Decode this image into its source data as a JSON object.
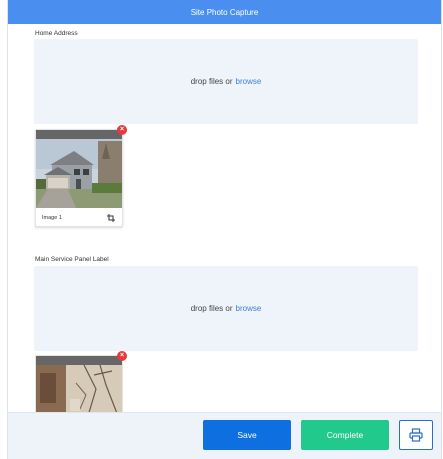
{
  "header": {
    "title": "Site Photo Capture"
  },
  "sections": [
    {
      "label": "Home Address",
      "dropzone": {
        "text": "drop files or",
        "link": "browse"
      },
      "image": {
        "caption": "Image 1",
        "remove": "×"
      }
    },
    {
      "label": "Main Service Panel Label",
      "dropzone": {
        "text": "drop files or",
        "link": "browse"
      },
      "image": {
        "remove": "×"
      }
    }
  ],
  "footer": {
    "save_label": "Save",
    "complete_label": "Complete",
    "print_icon": "printer-icon"
  },
  "colors": {
    "header": "#4a8ff0",
    "save": "#0d6fe0",
    "complete": "#22c98d",
    "remove": "#e53b3b",
    "link": "#3f7fd8"
  }
}
